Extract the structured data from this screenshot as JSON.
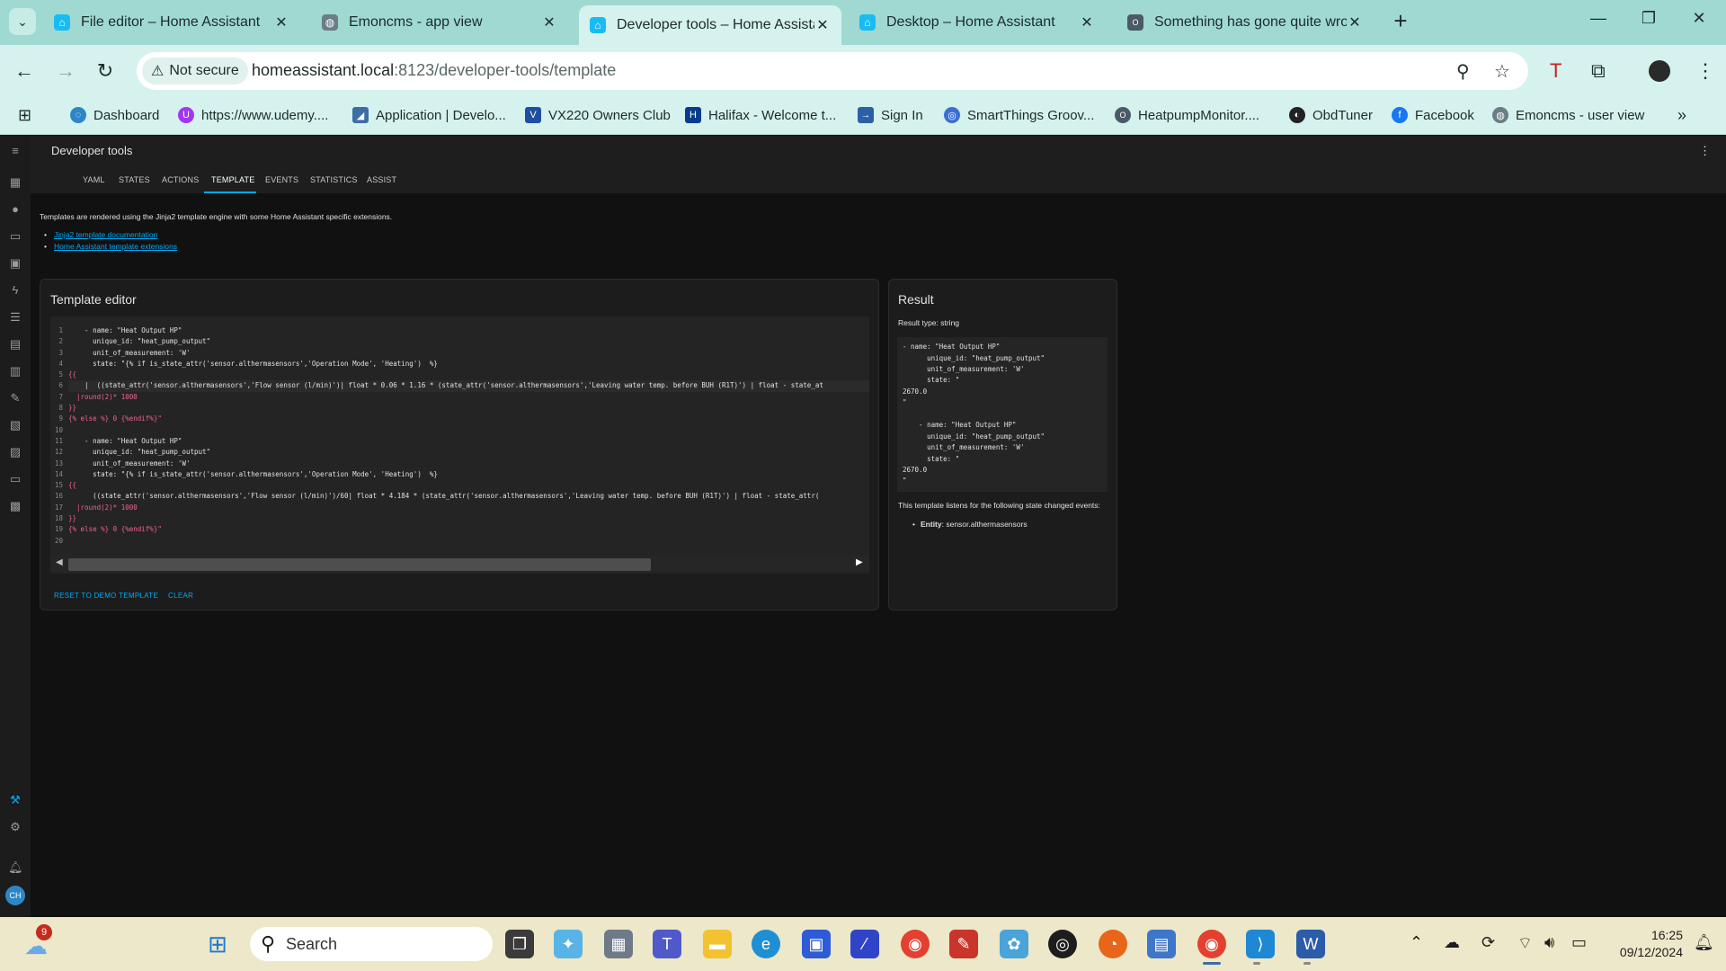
{
  "browser": {
    "tabs": [
      {
        "title": "File editor – Home Assistant",
        "icon": "home-assistant-icon",
        "active": false
      },
      {
        "title": "Emoncms - app view",
        "icon": "emoncms-icon",
        "active": false
      },
      {
        "title": "Developer tools – Home Assista",
        "icon": "home-assistant-icon",
        "active": true
      },
      {
        "title": "Desktop – Home Assistant",
        "icon": "home-assistant-icon",
        "active": false
      },
      {
        "title": "Something has gone quite wro",
        "icon": "openenergy-icon",
        "active": false
      }
    ],
    "security_label": "Not secure",
    "url_host": "homeassistant.local",
    "url_path": ":8123/developer-tools/template",
    "bookmarks": [
      "Dashboard",
      "https://www.udemy....",
      "Application | Develo...",
      "VX220 Owners Club",
      "Halifax - Welcome t...",
      "Sign In",
      "SmartThings Groov...",
      "HeatpumpMonitor....",
      "ObdTuner",
      "Facebook",
      "Emoncms - user view"
    ]
  },
  "ha": {
    "page_title": "Developer tools",
    "tabs": [
      "YAML",
      "STATES",
      "ACTIONS",
      "TEMPLATE",
      "EVENTS",
      "STATISTICS",
      "ASSIST"
    ],
    "active_tab": "TEMPLATE",
    "intro": "Templates are rendered using the Jinja2 template engine with some Home Assistant specific extensions.",
    "links": [
      "Jinja2 template documentation",
      "Home Assistant template extensions"
    ],
    "editor": {
      "title": "Template editor",
      "lines": [
        "    - name: \"Heat Output HP\"",
        "      unique_id: \"heat_pump_output\"",
        "      unit_of_measurement: 'W'",
        "      state: \"{% if is_state_attr('sensor.althermasensors','Operation Mode', 'Heating')  %}",
        "{{",
        "    |  ((state_attr('sensor.althermasensors','Flow sensor (l/min)')| float * 0.06 * 1.16 * (state_attr('sensor.althermasensors','Leaving water temp. before BUH (R1T)') | float - state_at",
        "  |round(2)* 1000",
        "}}",
        "{% else %} 0 {%endif%}\"",
        "",
        "    - name: \"Heat Output HP\"",
        "      unique_id: \"heat_pump_output\"",
        "      unit_of_measurement: 'W'",
        "      state: \"{% if is_state_attr('sensor.althermasensors','Operation Mode', 'Heating')  %}",
        "{{",
        "      ((state_attr('sensor.althermasensors','Flow sensor (l/min)')/60| float * 4.184 * (state_attr('sensor.althermasensors','Leaving water temp. before BUH (R1T)') | float - state_attr(",
        "  |round(2)* 1000",
        "}}",
        "{% else %} 0 {%endif%}\"",
        ""
      ],
      "reset_label": "RESET TO DEMO TEMPLATE",
      "clear_label": "CLEAR"
    },
    "result": {
      "title": "Result",
      "type_label": "Result type: string",
      "lines": [
        "- name: \"Heat Output HP\"",
        "      unique_id: \"heat_pump_output\"",
        "      unit_of_measurement: 'W'",
        "      state: \"",
        "2670.0",
        "\"",
        "",
        "    - name: \"Heat Output HP\"",
        "      unique_id: \"heat_pump_output\"",
        "      unit_of_measurement: 'W'",
        "      state: \"",
        "2670.0",
        "\""
      ],
      "listen_note": "This template listens for the following state changed events:",
      "entity_label": "Entity",
      "entity_value": ": sensor.althermasensors"
    },
    "avatar_initials": "CH"
  },
  "taskbar": {
    "search_placeholder": "Search",
    "weather_badge": "9",
    "time": "16:25",
    "date": "09/12/2024"
  }
}
